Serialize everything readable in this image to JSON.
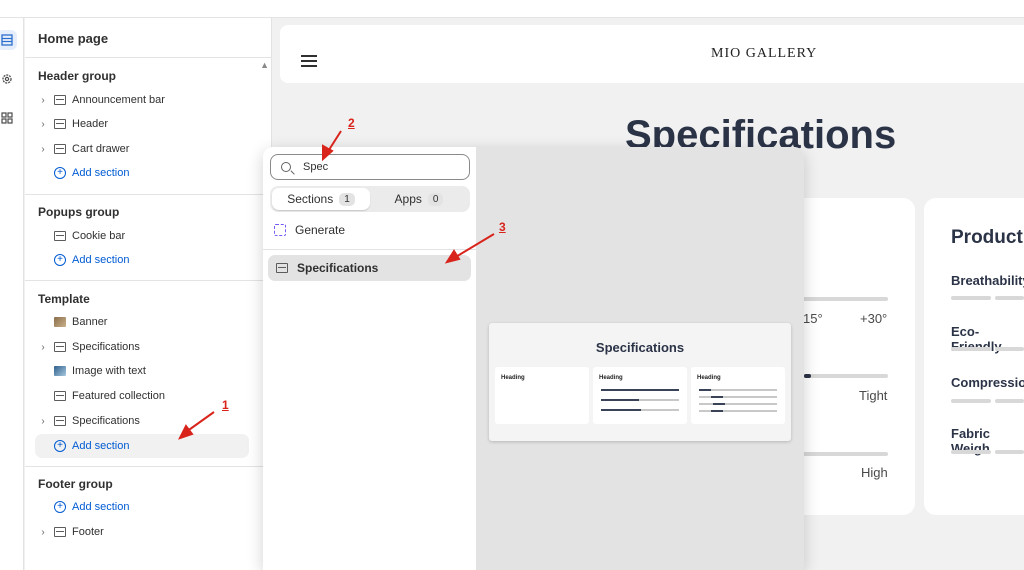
{
  "sidebar": {
    "title": "Home page",
    "header_group": {
      "title": "Header group",
      "items": [
        "Announcement bar",
        "Header",
        "Cart drawer"
      ],
      "add_label": "Add section"
    },
    "popups_group": {
      "title": "Popups group",
      "items": [
        "Cookie bar"
      ],
      "add_label": "Add section"
    },
    "template": {
      "title": "Template",
      "items": [
        "Banner",
        "Specifications",
        "Image with text",
        "Featured collection",
        "Specifications"
      ],
      "add_label": "Add section"
    },
    "footer_group": {
      "title": "Footer group",
      "add_label": "Add section",
      "items": [
        "Footer"
      ]
    }
  },
  "popup": {
    "search_value": "Spec",
    "tabs": [
      {
        "label": "Sections",
        "count": "1"
      },
      {
        "label": "Apps",
        "count": "0"
      }
    ],
    "generate_label": "Generate",
    "result_label": "Specifications",
    "preview": {
      "title": "Specifications",
      "cards": [
        "Heading",
        "Heading",
        "Heading"
      ]
    }
  },
  "preview": {
    "brand": "MIO GALLERY",
    "heading": "Specifications",
    "slider_texts": [
      "15°",
      "+30°",
      "Tight",
      "High"
    ],
    "product_card_title": "Product",
    "attributes": [
      "Breathability",
      "Eco-Friendly",
      "Compression",
      "Fabric Weigh"
    ]
  },
  "annotations": [
    "1",
    "2",
    "3"
  ],
  "colors": {
    "accent": "#005bd3",
    "annotation": "#d9241c",
    "heading": "#2b3347"
  }
}
